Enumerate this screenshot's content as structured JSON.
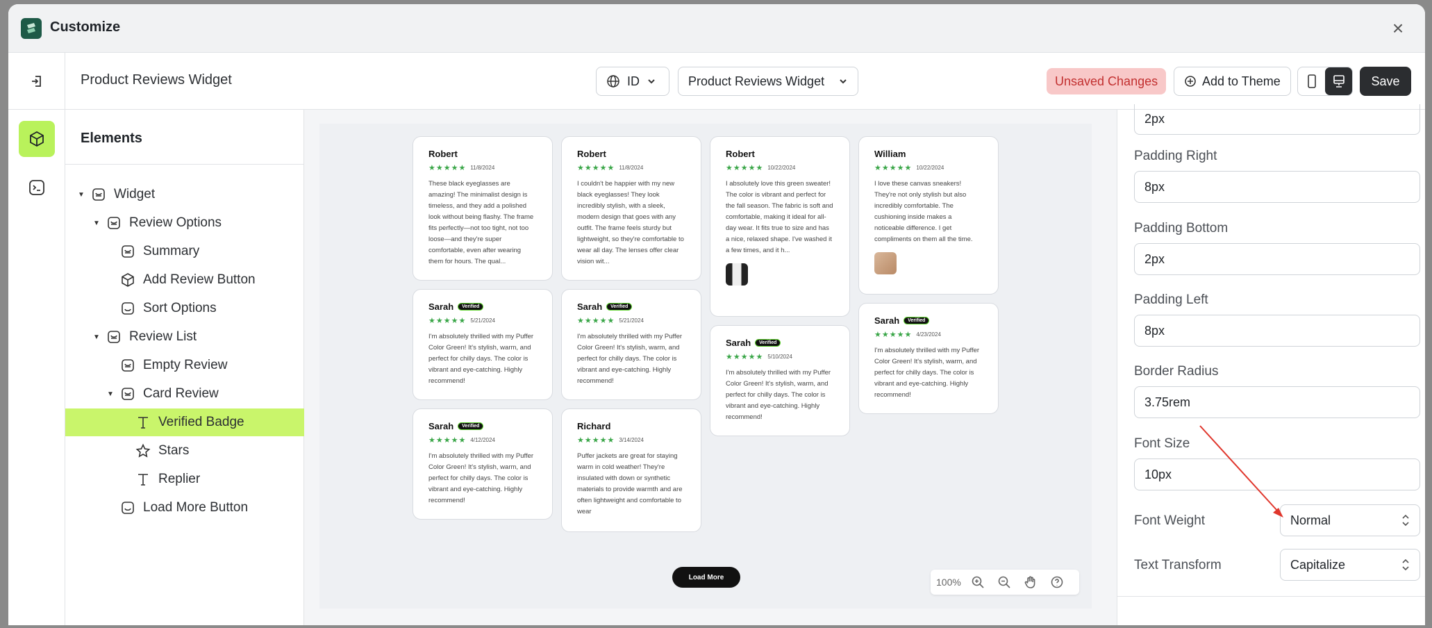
{
  "window": {
    "title": "Customize",
    "close": "×"
  },
  "toolbar": {
    "widget_name": "Product Reviews Widget",
    "language": "ID",
    "view": "Product Reviews Widget",
    "unsaved": "Unsaved Changes",
    "add_to_theme": "Add to Theme",
    "save": "Save"
  },
  "elements": {
    "heading": "Elements",
    "tree": [
      {
        "label": "Widget",
        "icon": "section-icon"
      },
      {
        "label": "Review Options",
        "icon": "section-icon"
      },
      {
        "label": "Summary",
        "icon": "section-icon"
      },
      {
        "label": "Add Review Button",
        "icon": "cube-icon"
      },
      {
        "label": "Sort Options",
        "icon": "block-icon"
      },
      {
        "label": "Review List",
        "icon": "section-icon"
      },
      {
        "label": "Empty Review",
        "icon": "section-icon"
      },
      {
        "label": "Card Review",
        "icon": "section-icon"
      },
      {
        "label": "Verified Badge",
        "icon": "text-icon"
      },
      {
        "label": "Stars",
        "icon": "star-icon"
      },
      {
        "label": "Replier",
        "icon": "text-icon"
      },
      {
        "label": "Load More Button",
        "icon": "block-icon"
      }
    ],
    "selected": "Verified Badge"
  },
  "preview": {
    "stars": "★★★★★",
    "badge": "Verified",
    "load_more": "Load More",
    "zoom": "100%",
    "cards": [
      {
        "name": "Robert",
        "date": "11/8/2024",
        "text": "These black eyeglasses are amazing! The minimalist design is timeless, and they add a polished look without being flashy. The frame fits perfectly—not too tight, not too loose—and they're super comfortable, even after wearing them for hours. The qual..."
      },
      {
        "name": "Robert",
        "date": "11/8/2024",
        "text": "I couldn't be happier with my new black eyeglasses! They look incredibly stylish, with a sleek, modern design that goes with any outfit. The frame feels sturdy but lightweight, so they're comfortable to wear all day. The lenses offer clear vision wit..."
      },
      {
        "name": "Robert",
        "date": "10/22/2024",
        "text": "I absolutely love this green sweater! The color is vibrant and perfect for the fall season. The fabric is soft and comfortable, making it ideal for all-day wear. It fits true to size and has a nice, relaxed shape. I've washed it a few times, and it h..."
      },
      {
        "name": "William",
        "date": "10/22/2024",
        "text": "I love these canvas sneakers! They're not only stylish but also incredibly comfortable. The cushioning inside makes a noticeable difference. I get compliments on them all the time."
      },
      {
        "name": "Sarah",
        "date": "5/21/2024",
        "text": "I'm absolutely thrilled with my Puffer Color Green! It's stylish, warm, and perfect for chilly days. The color is vibrant and eye-catching. Highly recommend!"
      },
      {
        "name": "Sarah",
        "date": "5/21/2024",
        "text": "I'm absolutely thrilled with my Puffer Color Green! It's stylish, warm, and perfect for chilly days. The color is vibrant and eye-catching. Highly recommend!"
      },
      {
        "name": "Sarah",
        "date": "5/10/2024",
        "text": "I'm absolutely thrilled with my Puffer Color Green! It's stylish, warm, and perfect for chilly days. The color is vibrant and eye-catching. Highly recommend!"
      },
      {
        "name": "Sarah",
        "date": "4/23/2024",
        "text": "I'm absolutely thrilled with my Puffer Color Green! It's stylish, warm, and perfect for chilly days. The color is vibrant and eye-catching. Highly recommend!"
      },
      {
        "name": "Sarah",
        "date": "4/12/2024",
        "text": "I'm absolutely thrilled with my Puffer Color Green! It's stylish, warm, and perfect for chilly days. The color is vibrant and eye-catching. Highly recommend!"
      },
      {
        "name": "Richard",
        "date": "3/14/2024",
        "text": "Puffer jackets are great for staying warm in cold weather! They're insulated with down or synthetic materials to provide warmth and are often lightweight and comfortable to wear"
      }
    ]
  },
  "settings": {
    "top_value": "2px",
    "padding_right_label": "Padding Right",
    "padding_right": "8px",
    "padding_bottom_label": "Padding Bottom",
    "padding_bottom": "2px",
    "padding_left_label": "Padding Left",
    "padding_left": "8px",
    "border_radius_label": "Border Radius",
    "border_radius": "3.75rem",
    "font_size_label": "Font Size",
    "font_size": "10px",
    "font_weight_label": "Font Weight",
    "font_weight": "Normal",
    "text_transform_label": "Text Transform",
    "text_transform": "Capitalize"
  },
  "colors": {
    "accent": "#c9f56b",
    "star": "#3aa648",
    "annotation_arrow": "#e0362c",
    "unsaved_bg": "#f8c8c8",
    "unsaved_text": "#c22f2f"
  }
}
